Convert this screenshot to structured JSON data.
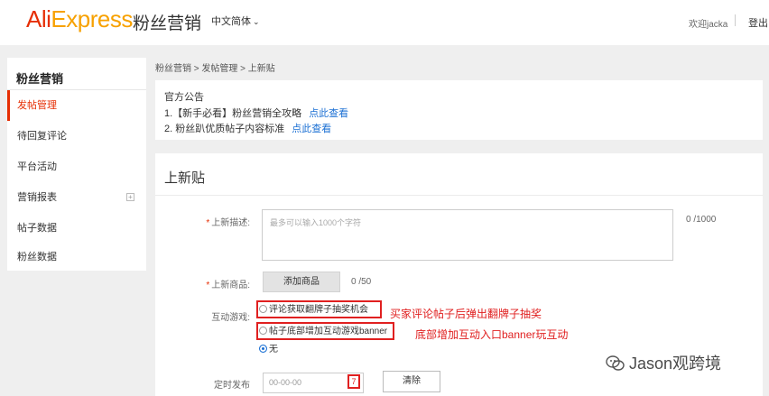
{
  "header": {
    "logo_ali": "Ali",
    "logo_express": "Express",
    "logo_sub": "粉丝营销",
    "language": "中文简体",
    "welcome": "欢迎jacka",
    "logout": "登出"
  },
  "sidebar": {
    "title": "粉丝营销",
    "items": [
      {
        "label": "发帖管理",
        "active": true
      },
      {
        "label": "待回复评论"
      },
      {
        "label": "平台活动"
      },
      {
        "label": "营销报表",
        "expandable": true
      },
      {
        "label": "帖子数据"
      },
      {
        "label": "粉丝数据"
      }
    ]
  },
  "breadcrumb": "粉丝营销 > 发帖管理 > 上新贴",
  "notice": {
    "title": "官方公告",
    "lines": [
      {
        "text": "1.【新手必看】粉丝营销全攻略",
        "link": "点此查看"
      },
      {
        "text": "2. 粉丝趴优质帖子内容标准",
        "link": "点此查看"
      }
    ]
  },
  "form": {
    "title": "上新贴",
    "desc_label": "上新描述:",
    "desc_placeholder": "最多可以输入1000个字符",
    "desc_counter": "0 /1000",
    "product_label": "上新商品:",
    "add_product": "添加商品",
    "product_counter": "0 /50",
    "game_label": "互动游戏:",
    "options": [
      {
        "label": "评论获取翻牌子抽奖机会",
        "selected": false
      },
      {
        "label": "帖子底部增加互动游戏banner",
        "selected": false
      },
      {
        "label": "无",
        "selected": true
      }
    ],
    "schedule_label": "定时发布",
    "date_placeholder": "00-00-00",
    "calendar_glyph": "7",
    "clear_button": "清除"
  },
  "annotations": [
    "买家评论帖子后弹出翻牌子抽奖",
    "底部增加互动入口banner玩互动"
  ],
  "watermark": "Jason观跨境",
  "colors": {
    "brand_red": "#e62e04",
    "brand_orange": "#f7a100",
    "link_blue": "#1a6fd3",
    "annotation_red": "#e02020"
  }
}
